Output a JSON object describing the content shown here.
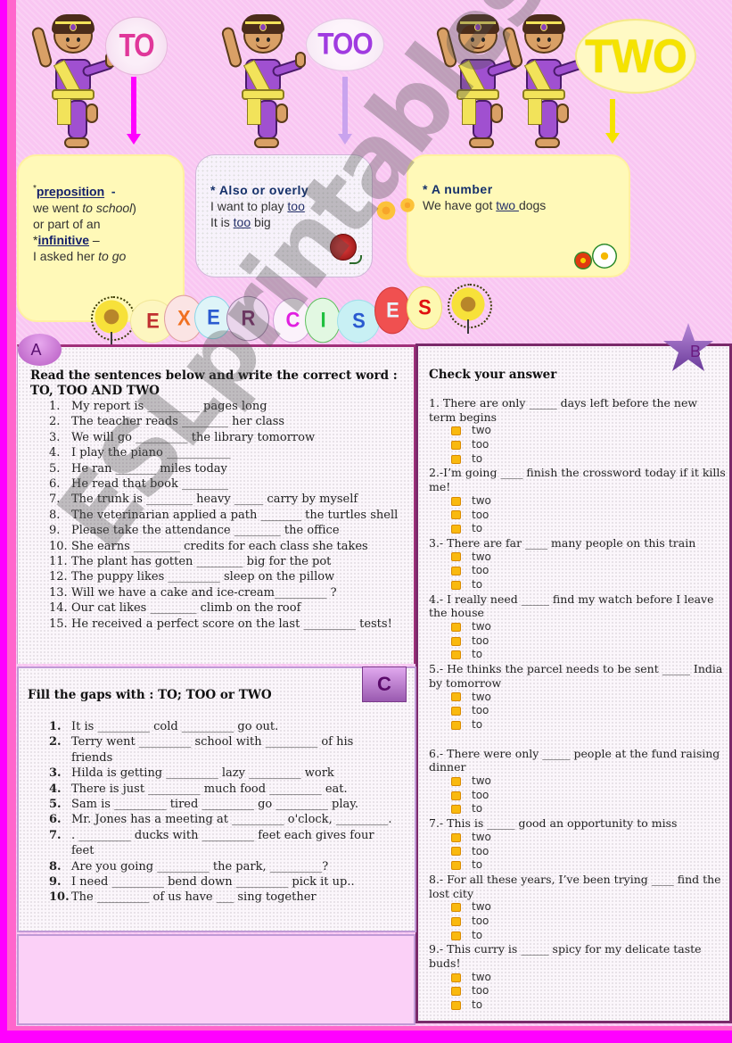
{
  "header": {
    "words": [
      "TO",
      "TOO",
      "TWO"
    ],
    "colors": {
      "to": "#e0379a",
      "too": "#a03be0",
      "two": "#f5e300"
    }
  },
  "definitions": {
    "to": {
      "star1": "*",
      "head1": "preposition",
      "dash1": "-",
      "line1_a": "we went ",
      "line1_b": "to school",
      "line1_c": ")",
      "line2": "or part of an",
      "star2": "*",
      "head2": "infinitive",
      "dash2": " –",
      "line3_a": "I asked her ",
      "line3_b": "to go"
    },
    "too": {
      "head": "* Also or overly",
      "line1_a": "I want to play ",
      "line1_b": "too",
      "line2_a": "It is ",
      "line2_b": "too",
      "line2_c": " big"
    },
    "two": {
      "head": "*  A number",
      "line1_a": "We have got ",
      "line1_b": "two ",
      "line1_c": "dogs"
    }
  },
  "exercises_banner": {
    "letters": [
      {
        "char": "E",
        "color": "#c03030",
        "bg": "#fdf6c0",
        "border": "#f2e89a"
      },
      {
        "char": "X",
        "color": "#f07020",
        "bg": "#fbe4e4",
        "border": "#e0a0a0"
      },
      {
        "char": "E",
        "color": "#2a5ad0",
        "bg": "#def4f8",
        "border": "#8ad6e8"
      },
      {
        "char": "R",
        "color": "#7a2a6a",
        "bg": "#ead6ec",
        "border": "#a080a8"
      },
      {
        "char": "C",
        "color": "#e020e0",
        "bg": "#fbf2fb",
        "border": "#d0a0d8"
      },
      {
        "char": "I",
        "color": "#20c040",
        "bg": "#e2f8e2",
        "border": "#60c060"
      },
      {
        "char": "S",
        "color": "#2a5ad0",
        "bg": "#c8f0f4",
        "border": "#a0e0ea"
      },
      {
        "char": "E",
        "color": "#e8f4ff",
        "bg": "#f05050",
        "border": "#d03a3a"
      },
      {
        "char": "S",
        "color": "#e01010",
        "bg": "#fdf8b0",
        "border": "#f0e070"
      }
    ]
  },
  "section_a": {
    "badge": "A",
    "title": "Read the sentences below and write the correct word : TO, TOO AND TWO",
    "items": [
      {
        "n": "1.",
        "text": "My report is _________ pages long"
      },
      {
        "n": "2.",
        "text": "The teacher reads ________ her class"
      },
      {
        "n": "3.",
        "text": "We will go _________ the library tomorrow"
      },
      {
        "n": "4.",
        "text": "I play the piano ___________"
      },
      {
        "n": "5.",
        "text": "He ran _______ miles today"
      },
      {
        "n": "6.",
        "text": "He read that book ________"
      },
      {
        "n": "7.",
        "text": "The trunk is ________ heavy _____ carry by myself"
      },
      {
        "n": "8.",
        "text": "The  veterinarian applied a path _______ the turtles shell"
      },
      {
        "n": "9.",
        "text": "Please take the attendance ________ the office"
      },
      {
        "n": "10.",
        "text": "She earns ________ credits for each class she takes"
      },
      {
        "n": "11.",
        "text": "The plant has gotten ________ big for the pot"
      },
      {
        "n": "12.",
        "text": "The puppy likes _________ sleep on the pillow"
      },
      {
        "n": "13.",
        "text": "Will we have a cake and ice-cream_________ ?"
      },
      {
        "n": "14.",
        "text": "Our cat likes ________ climb on the roof"
      },
      {
        "n": "15.",
        "text": "He received a perfect score on the last _________ tests!"
      }
    ]
  },
  "section_b": {
    "badge": "B",
    "title": "Check your answer",
    "options": [
      "two",
      "too",
      "to"
    ],
    "questions": [
      {
        "text": "1. There are only _____ days left before the new term begins"
      },
      {
        "text": "2.-I’m going ____ finish the crossword today if it kills me!"
      },
      {
        "text": "3.- There are far ____ many people on this train"
      },
      {
        "text": "4.- I really need _____ find my watch before I leave the house"
      },
      {
        "text": "5.- He thinks the parcel needs to be sent _____ India by tomorrow"
      },
      {
        "text": "6.- There were only _____ people at the fund raising dinner"
      },
      {
        "text": "7.- This is _____ good an opportunity to miss"
      },
      {
        "text": "8.- For all these years, I’ve been trying ____ find the lost city"
      },
      {
        "text": "9.- This curry is _____ spicy for my delicate taste buds!"
      }
    ]
  },
  "section_c": {
    "badge": "C",
    "title": "Fill the gaps with : TO; TOO or TWO",
    "items": [
      {
        "n": "1.",
        "text": "It is _________ cold _________ go out."
      },
      {
        "n": "2.",
        "text": "Terry went _________ school with _________ of his friends"
      },
      {
        "n": "3.",
        "text": "Hilda is getting _________ lazy _________ work"
      },
      {
        "n": "4.",
        "text": "There is just _________ much food _________ eat."
      },
      {
        "n": "5.",
        "text": "Sam is _________ tired _________ go _________ play."
      },
      {
        "n": "6.",
        "text": "Mr. Jones has a meeting at _________ o'clock, _________."
      },
      {
        "n": "7.",
        "text": ". _________ ducks with _________ feet each gives four feet"
      },
      {
        "n": "8.",
        "text": "Are you going _________ the park, _________?"
      },
      {
        "n": "9.",
        "text": "I need _________ bend down _________ pick it up.."
      },
      {
        "n": "10.",
        "text": "The _________ of us have ___ sing together"
      }
    ]
  },
  "watermark": "ESLprintables.com"
}
